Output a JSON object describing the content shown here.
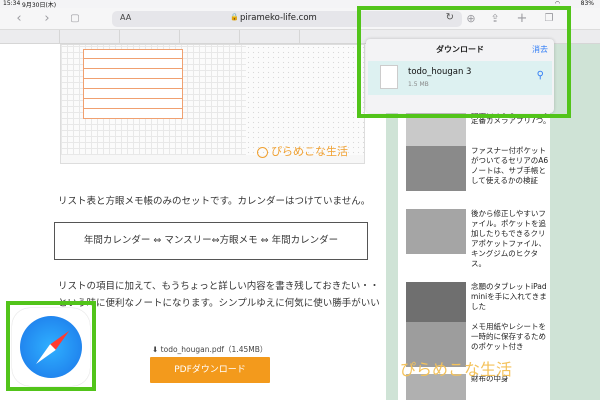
{
  "status_bar": {
    "time": "15:34",
    "date": "9月30日(木)",
    "battery": "83%"
  },
  "toolbar": {
    "text_size": "AA",
    "url": "pirameko-life.com"
  },
  "article": {
    "paragraph1": "リスト表と方眼メモ帳のみのセットです。カレンダーはつけていません。",
    "boxed_text": "年間カレンダー ⇔ マンスリー⇔方眼メモ ⇔ 年間カレンダー",
    "paragraph2_line1": "リストの項目に加えて、もうちょっと詳しい内容を書き残しておきたい・・",
    "paragraph2_line2": "という時に便利なノートになります。シンプルゆえに何気に使い勝手がいい",
    "download_link": "todo_hougan.pdf（1.45MB）",
    "pdf_button": "PDFダウンロード",
    "logo_text": "ぴらめこな生活"
  },
  "downloads": {
    "title": "ダウンロード",
    "clear": "消去",
    "file_name": "todo_hougan 3",
    "file_size": "1.5 MB"
  },
  "sidebar": {
    "items": [
      {
        "text": "話題スマホなiPhoneの定番カメラアプリ7つ。"
      },
      {
        "text": "ファスナー付ポケットがついてるセリアのA6ノートは、サブ手帳として使えるかの検証"
      },
      {
        "text": "後から修正しやすいファイル。ポケットを追加したりもできるクリアポケットファイル、キングジムのヒクタス。"
      },
      {
        "text": "念願のタブレットiPad miniを手に入れてきました"
      },
      {
        "text": "メモ用紙やレシートを一時的に保存するためのポケット付き"
      },
      {
        "text": "財布の中身"
      }
    ],
    "watermark": "ぴらめこな生活"
  }
}
